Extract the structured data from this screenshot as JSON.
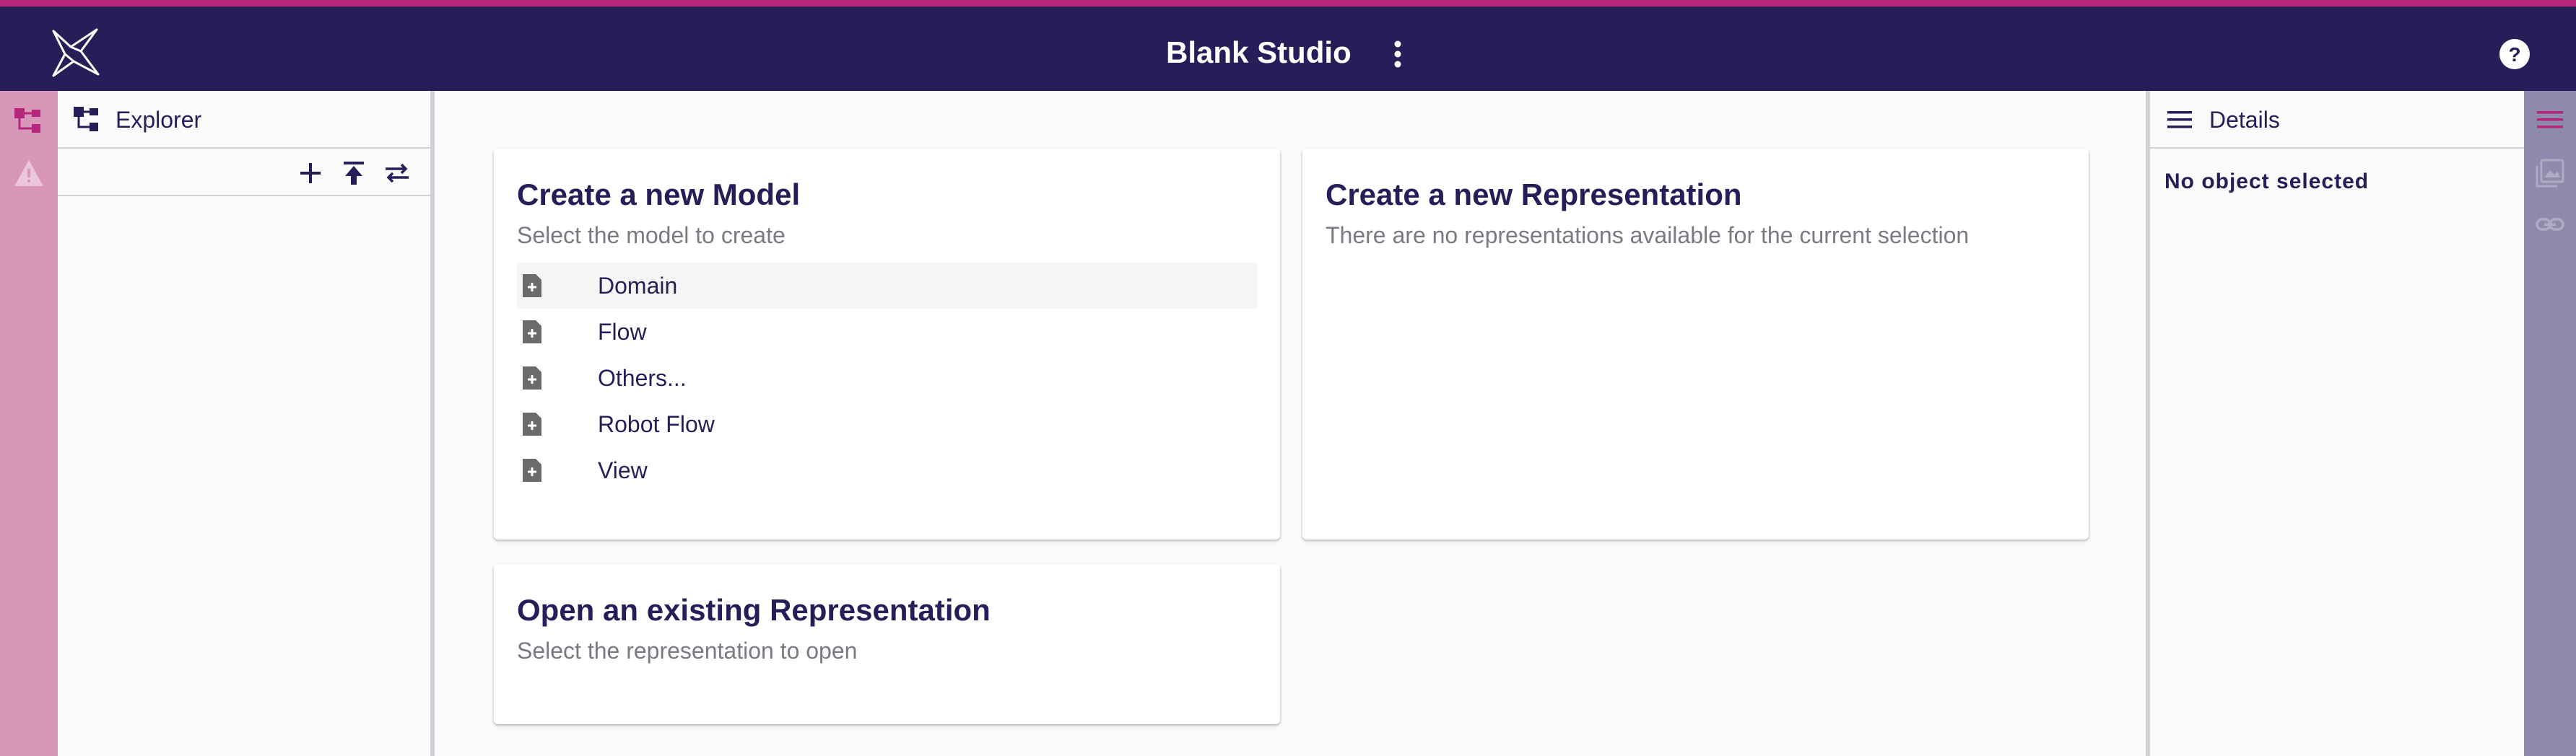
{
  "app": {
    "title": "Blank Studio",
    "accent_color": "#b5257c",
    "header_color": "#261e58"
  },
  "icons": {
    "logo": "sirius-star-logo",
    "menu": "more-vert-icon",
    "help": "help-circle-icon"
  },
  "left_bar": {
    "items": [
      {
        "icon": "explorer-tree-icon",
        "active": true
      },
      {
        "icon": "warning-icon",
        "active": false
      }
    ]
  },
  "explorer": {
    "title": "Explorer",
    "toolbar": [
      "add-icon",
      "upload-icon",
      "synchronize-icon"
    ]
  },
  "cards": {
    "new_model": {
      "title": "Create a new Model",
      "subtitle": "Select the model to create",
      "items": [
        {
          "label": "Domain"
        },
        {
          "label": "Flow"
        },
        {
          "label": "Others..."
        },
        {
          "label": "Robot Flow"
        },
        {
          "label": "View"
        }
      ]
    },
    "new_representation": {
      "title": "Create a new Representation",
      "subtitle": "There are no representations available for the current selection"
    },
    "open_representation": {
      "title": "Open an existing Representation",
      "subtitle": "Select the representation to open"
    }
  },
  "details": {
    "title": "Details",
    "empty_text": "No object selected"
  },
  "right_bar": {
    "items": [
      {
        "icon": "details-menu-icon",
        "active": true
      },
      {
        "icon": "image-gallery-icon",
        "active": false
      },
      {
        "icon": "link-icon",
        "active": false
      }
    ]
  }
}
